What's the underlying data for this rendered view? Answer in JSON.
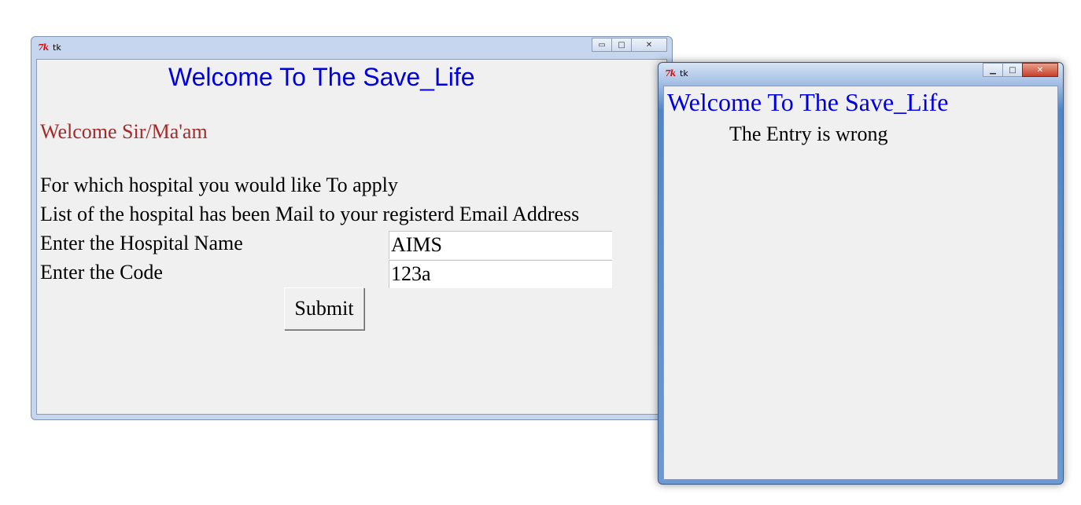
{
  "main_window": {
    "title": "tk",
    "controls": {
      "minimize": "▭",
      "maximize": "□",
      "close": "✕"
    },
    "heading": "Welcome To The Save_Life",
    "greeting": "Welcome Sir/Ma'am",
    "question": "For which hospital you would like To apply",
    "info": "List of the hospital has been Mail to your registerd Email Address",
    "hospital_label": "Enter the Hospital Name",
    "hospital_value": "AIMS",
    "code_label": "Enter the Code",
    "code_value": "123a",
    "submit_label": "Submit"
  },
  "popup_window": {
    "title": "tk",
    "controls": {
      "minimize": "▁",
      "maximize": "□",
      "close": "✕"
    },
    "heading": "Welcome To The Save_Life",
    "message": "The Entry is wrong"
  },
  "colors": {
    "heading": "#0000dd",
    "greeting": "#a52a2a",
    "client_bg": "#f0f0f0"
  },
  "icons": [
    "tk-feather-icon",
    "minimize-icon",
    "maximize-icon",
    "close-icon"
  ]
}
